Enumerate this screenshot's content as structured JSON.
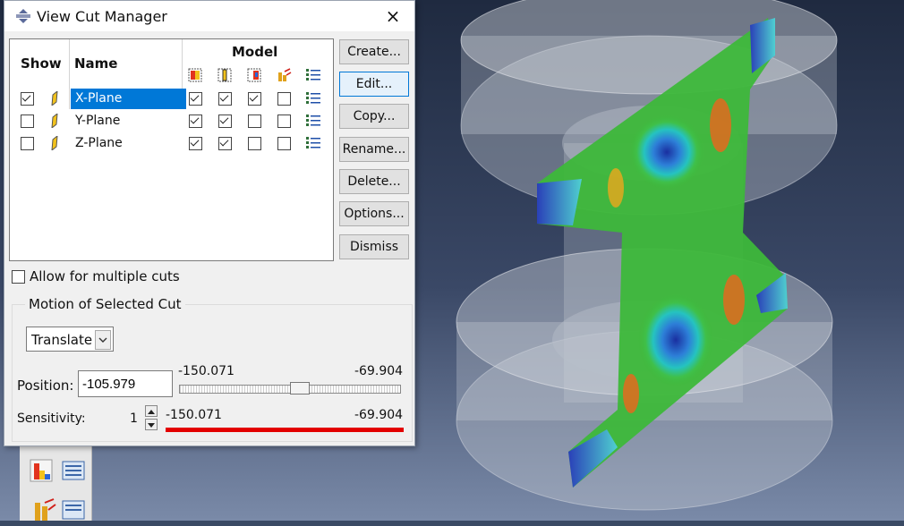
{
  "dialog": {
    "title": "View Cut Manager",
    "close_label": "×"
  },
  "table": {
    "headers": {
      "show": "Show",
      "name": "Name",
      "model": "Model"
    },
    "model_columns": [
      "color-contour-icon",
      "cut-face-icon",
      "above-cut-icon",
      "below-cut-icon",
      "options-list-icon"
    ],
    "rows": [
      {
        "name": "X-Plane",
        "show": true,
        "selected": true,
        "model": [
          true,
          true,
          true,
          false
        ]
      },
      {
        "name": "Y-Plane",
        "show": false,
        "selected": false,
        "model": [
          true,
          true,
          false,
          false
        ]
      },
      {
        "name": "Z-Plane",
        "show": false,
        "selected": false,
        "model": [
          true,
          true,
          false,
          false
        ]
      }
    ]
  },
  "buttons": {
    "create": "Create...",
    "edit": "Edit...",
    "copy": "Copy...",
    "rename": "Rename...",
    "delete": "Delete...",
    "options": "Options...",
    "dismiss": "Dismiss"
  },
  "allow_multiple": {
    "label": "Allow for multiple cuts",
    "checked": false
  },
  "motion": {
    "group_title": "Motion of Selected Cut",
    "mode": "Translate",
    "position_label": "Position:",
    "position_value": "-105.979",
    "position_min": "-150.071",
    "position_max": "-69.904",
    "position_fraction": 0.55,
    "sensitivity_label": "Sensitivity:",
    "sensitivity_value": "1",
    "sensitivity_min": "-150.071",
    "sensitivity_max": "-69.904"
  },
  "colors": {
    "accent": "#0078d7",
    "range_bar": "#e30000",
    "viewport_bg": "#2c3a55"
  }
}
